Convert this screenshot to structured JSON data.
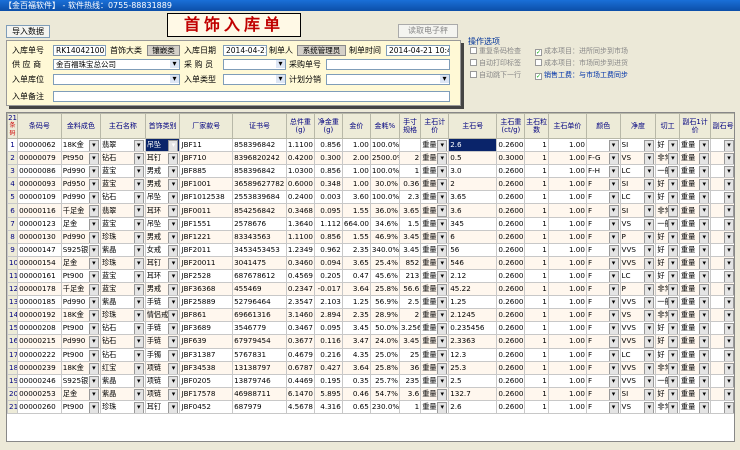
{
  "window": {
    "title": "【金百福软件】 - 软件热线：0755-88831889"
  },
  "toolbar": {
    "import_label": "导入数据",
    "read_tag_label": "读取电子秤"
  },
  "page": {
    "title": "首饰入库单"
  },
  "form": {
    "receipt_no_label": "入库单号",
    "receipt_no": "RK140421001",
    "jewelry_category_label": "首饰大类",
    "jewelry_category": "镶嵌类",
    "date_label": "入库日期",
    "date": "2014-04-21",
    "maker_label": "制单人",
    "maker": "系统管理员",
    "make_time_label": "制单时间",
    "make_time": "2014-04-21 10:47",
    "supplier_label": "供 应 商",
    "supplier": "金百福珠宝总公司",
    "purchaser_label": "采 购 员",
    "purchaser": "",
    "purchase_no_label": "采购单号",
    "purchase_no": "",
    "location_label": "入单库位",
    "location": "",
    "type_label": "入单类型",
    "type": "",
    "method_label": "计划分销",
    "method": "",
    "remark_label": "入单备注",
    "remark": ""
  },
  "options": {
    "title": "操作选项",
    "items": [
      {
        "label": "重复条码检查",
        "checked": false
      },
      {
        "label": "成本项目：进所同步到市场",
        "checked": true
      },
      {
        "label": "自动打印标签",
        "checked": false
      },
      {
        "label": "成本项目：市场同步到进货",
        "checked": false
      },
      {
        "label": "自动跳下一行",
        "checked": false
      },
      {
        "label": "销售工费：与市场工费同步",
        "checked": true
      }
    ]
  },
  "grid": {
    "corner_top": "21",
    "corner_bottom": "条码",
    "headers": [
      "条码号",
      "金料成色",
      "主石名称",
      "首饰类别",
      "厂家款号",
      "证书号",
      "总件重(g)",
      "净金重(g)",
      "金价",
      "金耗%",
      "手寸规格",
      "主石计价",
      "主石号",
      "主石重(ct/g)",
      "主石粒数",
      "主石单价",
      "颜色",
      "净度",
      "切工",
      "副石1计价",
      "副石号"
    ],
    "rows": [
      [
        "00000062",
        "18K金",
        "翡翠",
        "吊坠",
        "JBF11",
        "858396842",
        "1.1100",
        "0.856",
        "1.00",
        "100.0%",
        "",
        "重量",
        "2.6",
        "0.2600",
        "1",
        "1.00",
        "",
        "SI",
        "好",
        "重量",
        ""
      ],
      [
        "00000079",
        "Pt950",
        "钻石",
        "耳钉",
        "JBF710",
        "8396820242",
        "0.4200",
        "0.300",
        "2.00",
        "2500.0%",
        "2",
        "重量",
        "0.5",
        "0.3000",
        "1",
        "1.00",
        "F-G",
        "VS",
        "非常",
        "重量",
        ""
      ],
      [
        "00000086",
        "Pd990",
        "蓝宝",
        "男戒",
        "JBF885",
        "858396842",
        "1.0300",
        "0.856",
        "1.00",
        "100.0%",
        "1",
        "重量",
        "3.0",
        "0.2600",
        "1",
        "1.00",
        "F-H",
        "LC",
        "一般",
        "重量",
        ""
      ],
      [
        "00000093",
        "Pd950",
        "蓝宝",
        "男戒",
        "JBF1001",
        "36589627782",
        "0.6000",
        "0.348",
        "1.00",
        "30.0%",
        "0.36",
        "重量",
        "2",
        "0.2600",
        "1",
        "1.00",
        "F",
        "SI",
        "好",
        "重量",
        ""
      ],
      [
        "00000109",
        "Pd990",
        "钻石",
        "吊坠",
        "JBF1012538",
        "2553839684",
        "0.2400",
        "0.003",
        "3.60",
        "100.0%",
        "2.3",
        "重量",
        "3.65",
        "0.2600",
        "1",
        "1.00",
        "F",
        "LC",
        "好",
        "重量",
        ""
      ],
      [
        "00000116",
        "千足金",
        "翡翠",
        "耳环",
        "JBF0011",
        "854256842",
        "0.3468",
        "0.095",
        "1.55",
        "36.0%",
        "3.65",
        "重量",
        "3.6",
        "0.2600",
        "1",
        "1.00",
        "F",
        "SI",
        "非常",
        "重量",
        ""
      ],
      [
        "00000123",
        "足金",
        "蓝宝",
        "吊坠",
        "JBF1551",
        "2578676",
        "1.3640",
        "1.112",
        "664.00",
        "34.6%",
        "1.5",
        "重量",
        "345",
        "0.2600",
        "1",
        "1.00",
        "F",
        "VS",
        "一般",
        "重量",
        ""
      ],
      [
        "00000130",
        "Pd990",
        "珍珠",
        "男戒",
        "JBF1221",
        "83343563",
        "1.1100",
        "0.856",
        "1.55",
        "46.9%",
        "3.45",
        "重量",
        "6",
        "0.2600",
        "1",
        "1.00",
        "F",
        "P",
        "好",
        "重量",
        ""
      ],
      [
        "00000147",
        "S925银",
        "紫晶",
        "女戒",
        "JBF2011",
        "3453453453",
        "1.2349",
        "0.962",
        "2.35",
        "340.0%",
        "3.45",
        "重量",
        "56",
        "0.2600",
        "1",
        "1.00",
        "F",
        "VVS",
        "好",
        "重量",
        ""
      ],
      [
        "00000154",
        "足金",
        "珍珠",
        "耳钉",
        "JBF20011",
        "3041475",
        "0.3460",
        "0.094",
        "3.65",
        "25.4%",
        "852",
        "重量",
        "546",
        "0.2600",
        "1",
        "1.00",
        "F",
        "VVS",
        "好",
        "重量",
        ""
      ],
      [
        "00000161",
        "Pt900",
        "蓝宝",
        "耳环",
        "JBF2528",
        "687678612",
        "0.4569",
        "0.205",
        "0.47",
        "45.6%",
        "213",
        "重量",
        "2.12",
        "0.2600",
        "1",
        "1.00",
        "F",
        "LC",
        "好",
        "重量",
        ""
      ],
      [
        "00000178",
        "千足金",
        "蓝宝",
        "男戒",
        "JBF36368",
        "455469",
        "0.2347",
        "-0.017",
        "3.64",
        "25.8%",
        "56.6",
        "重量",
        "45.22",
        "0.2600",
        "1",
        "1.00",
        "F",
        "P",
        "非常",
        "重量",
        ""
      ],
      [
        "00000185",
        "Pd990",
        "紫晶",
        "手链",
        "JBF25889",
        "52796464",
        "2.3547",
        "2.103",
        "1.25",
        "56.9%",
        "2.5",
        "重量",
        "1.25",
        "0.2600",
        "1",
        "1.00",
        "F",
        "VVS",
        "一般",
        "重量",
        ""
      ],
      [
        "00000192",
        "18K金",
        "珍珠",
        "情侣戒",
        "JBF861",
        "69661316",
        "3.1460",
        "2.894",
        "2.35",
        "28.9%",
        "2",
        "重量",
        "2.1245",
        "0.2600",
        "1",
        "1.00",
        "F",
        "VS",
        "非常",
        "重量",
        ""
      ],
      [
        "00000208",
        "Pt900",
        "钻石",
        "手链",
        "JBF3689",
        "3546779",
        "0.3467",
        "0.095",
        "3.45",
        "50.0%",
        "3.256",
        "重量",
        "0.235456",
        "0.2600",
        "1",
        "1.00",
        "F",
        "VVS",
        "好",
        "重量",
        ""
      ],
      [
        "00000215",
        "Pd990",
        "钻石",
        "手链",
        "JBF639",
        "67979454",
        "0.3677",
        "0.116",
        "3.47",
        "24.0%",
        "3.45",
        "重量",
        "2.3363",
        "0.2600",
        "1",
        "1.00",
        "F",
        "VVS",
        "好",
        "重量",
        ""
      ],
      [
        "00000222",
        "Pt900",
        "钻石",
        "手镯",
        "JBF31387",
        "5767831",
        "0.4679",
        "0.216",
        "4.35",
        "25.0%",
        "25",
        "重量",
        "12.3",
        "0.2600",
        "1",
        "1.00",
        "F",
        "LC",
        "好",
        "重量",
        ""
      ],
      [
        "00000239",
        "18K金",
        "红宝",
        "项链",
        "JBF34538",
        "13138797",
        "0.6787",
        "0.427",
        "3.64",
        "25.8%",
        "36",
        "重量",
        "25.3",
        "0.2600",
        "1",
        "1.00",
        "F",
        "VVS",
        "非常",
        "重量",
        ""
      ],
      [
        "00000246",
        "S925银",
        "紫晶",
        "项链",
        "JBF0205",
        "13879746",
        "0.4469",
        "0.195",
        "0.35",
        "25.7%",
        "235",
        "重量",
        "2.5",
        "0.2600",
        "1",
        "1.00",
        "F",
        "VVS",
        "一般",
        "重量",
        ""
      ],
      [
        "00000253",
        "足金",
        "紫晶",
        "项链",
        "JBF17578",
        "46988711",
        "6.1470",
        "5.895",
        "0.46",
        "54.7%",
        "3.6",
        "重量",
        "132.7",
        "0.2600",
        "1",
        "1.00",
        "F",
        "SI",
        "好",
        "重量",
        ""
      ],
      [
        "00000260",
        "Pt900",
        "珍珠",
        "耳钉",
        "JBF0452",
        "687979",
        "4.5678",
        "4.316",
        "0.65",
        "230.0%",
        "1",
        "重量",
        "2.6",
        "0.2600",
        "1",
        "1.00",
        "F",
        "VS",
        "非常",
        "重量",
        ""
      ]
    ]
  }
}
